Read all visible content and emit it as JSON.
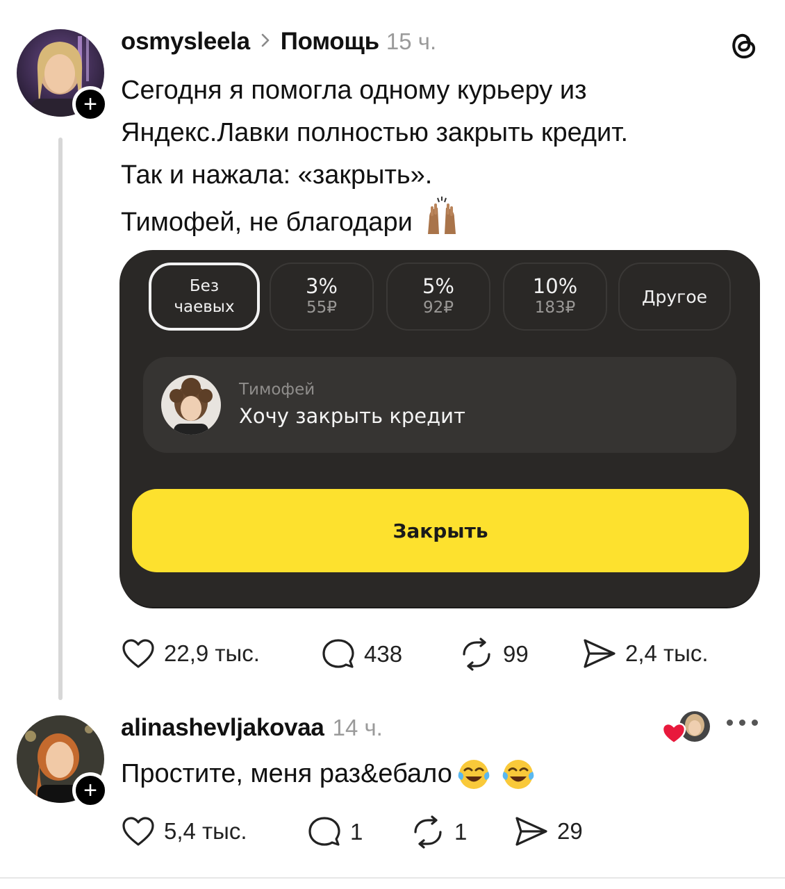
{
  "post": {
    "username": "osmysleela",
    "topic": "Помощь",
    "time": "15 ч.",
    "lines": [
      "Сегодня я помогла одному курьеру из",
      "Яндекс.Лавки полностью закрыть кредит.",
      "Так и нажала: «закрыть».",
      "Тимофей, не благодари"
    ],
    "emoji_icon": "raised-hands-emoji",
    "stats": {
      "likes": "22,9 тыс.",
      "comments": "438",
      "reposts": "99",
      "shares": "2,4 тыс."
    }
  },
  "card": {
    "tips": [
      {
        "line1": "Без",
        "line2": "чаевых",
        "selected": true
      },
      {
        "pct": "3%",
        "amount": "55₽"
      },
      {
        "pct": "5%",
        "amount": "92₽"
      },
      {
        "pct": "10%",
        "amount": "183₽"
      },
      {
        "other": "Другое"
      }
    ],
    "message": {
      "name": "Тимофей",
      "text": "Хочу закрыть кредит"
    },
    "button": "Закрыть",
    "colors": {
      "background": "#2a2826",
      "button": "#fde12e"
    }
  },
  "reply": {
    "username": "alinashevljakovaa",
    "time": "14 ч.",
    "text": "Простите, меня раз&ебало",
    "emoji_icons": [
      "tears-of-joy-emoji",
      "tears-of-joy-emoji"
    ],
    "stats": {
      "likes": "5,4 тыс.",
      "comments": "1",
      "reposts": "1",
      "shares": "29"
    }
  }
}
